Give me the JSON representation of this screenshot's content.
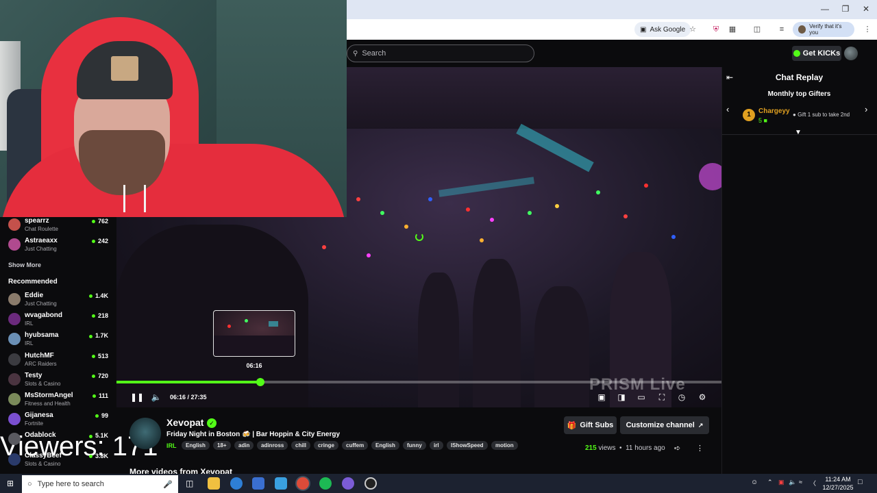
{
  "browser": {
    "ask_google": "Ask Google",
    "verify": "Verify that it's you"
  },
  "site": {
    "search_placeholder": "Search",
    "get_kicks": "Get KICKs"
  },
  "player": {
    "preview_time": "06:16",
    "time": "06:16 / 27:35",
    "progress": 0.2375,
    "watermark": "PRISM Live"
  },
  "sidebar": {
    "following": [
      {
        "name": "spearrz",
        "category": "Chat Roulette",
        "viewers": "762",
        "color": "#c4514b"
      },
      {
        "name": "Astraeaxx",
        "category": "Just Chatting",
        "viewers": "242",
        "color": "#b04a8f"
      }
    ],
    "show_more": "Show More",
    "recommended_label": "Recommended",
    "recommended": [
      {
        "name": "Eddie",
        "category": "Just Chatting",
        "viewers": "1.4K",
        "color": "#8a7b6b"
      },
      {
        "name": "wvagabond",
        "category": "IRL",
        "viewers": "218",
        "color": "#6b2a7d"
      },
      {
        "name": "hyubsama",
        "category": "IRL",
        "viewers": "1.7K",
        "color": "#6a8fb5"
      },
      {
        "name": "HutchMF",
        "category": "ARC Raiders",
        "viewers": "513",
        "color": "#3b3b40"
      },
      {
        "name": "Testy",
        "category": "Slots & Casino",
        "viewers": "720",
        "color": "#4a3440"
      },
      {
        "name": "MsStormAngel",
        "category": "Fitness and Health",
        "viewers": "111",
        "color": "#7a8a5a"
      },
      {
        "name": "Gijanesa",
        "category": "Fortnite",
        "viewers": "99",
        "color": "#7a4fd0"
      },
      {
        "name": "Odablock",
        "category": "",
        "viewers": "5.1K",
        "color": "#5a5a60"
      },
      {
        "name": "ClassyBeef",
        "category": "Slots & Casino",
        "viewers": "3.8K",
        "color": "#2a3a6a"
      }
    ],
    "overlay_viewers": "Viewers: 171"
  },
  "channel": {
    "name": "Xevopat",
    "title": "Friday Night in Boston 🍻 | Bar Hoppin & City Energy",
    "category": "IRL",
    "tags": [
      "English",
      "18+",
      "adin",
      "adinross",
      "chill",
      "cringe",
      "cuffem",
      "English",
      "funny",
      "irl",
      "IShowSpeed",
      "motion"
    ],
    "gift_subs": "Gift Subs",
    "customize": "Customize channel",
    "views_count": "215",
    "views_label": "views",
    "age": "11 hours ago",
    "more_videos": "More videos from Xevopat"
  },
  "chat": {
    "title": "Chat Replay",
    "gifters_title": "Monthly top Gifters",
    "top_gifter_rank": "1",
    "top_gifter_name": "Chargeyy",
    "top_gifter_count": "5",
    "gift_hint": "Gift 1 sub to take 2nd"
  },
  "taskbar": {
    "search_placeholder": "Type here to search",
    "time": "11:24 AM",
    "date": "12/27/2025"
  },
  "colors": {
    "accent": "#53fc18",
    "background": "#0b0b0d"
  }
}
